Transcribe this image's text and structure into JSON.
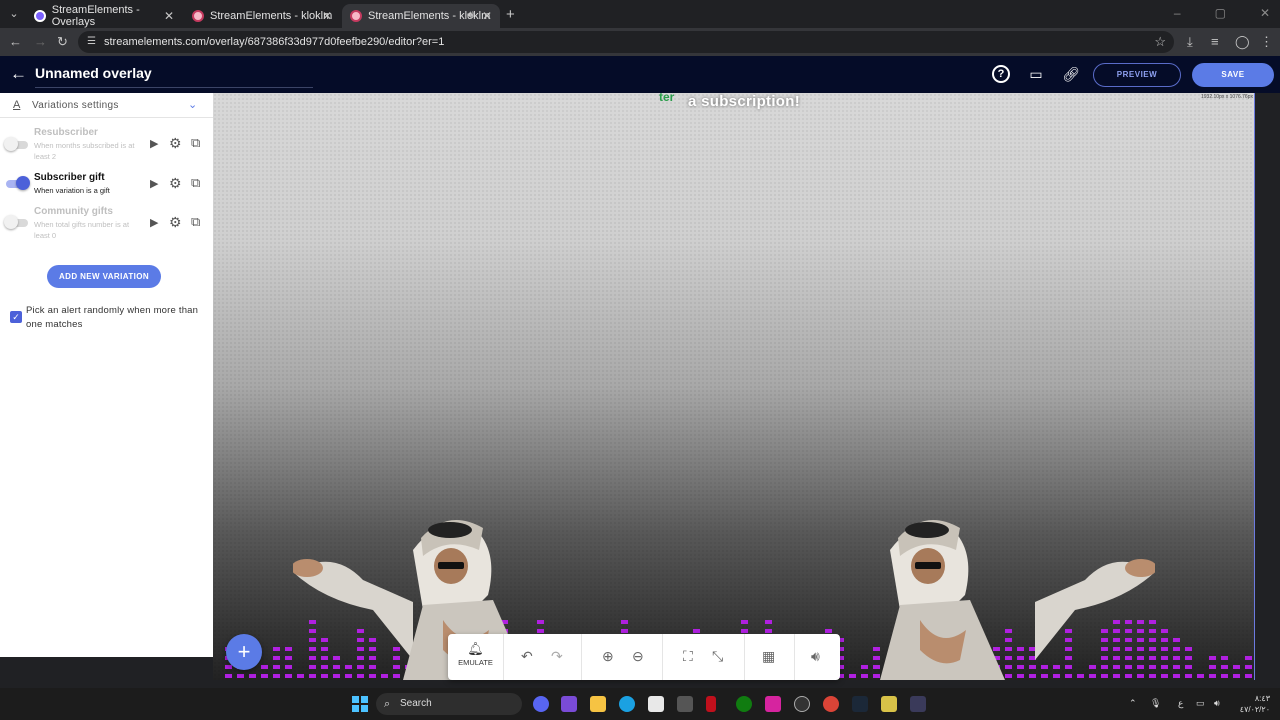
{
  "browser": {
    "tabs": [
      {
        "title": "StreamElements - Overlays",
        "active": false
      },
      {
        "title": "StreamElements - kloklm",
        "active": false
      },
      {
        "title": "StreamElements - kloklm",
        "active": true
      }
    ],
    "url": "streamelements.com/overlay/687386f33d977d0feefbe290/editor?er=1"
  },
  "header": {
    "title": "Unnamed overlay",
    "preview_label": "PREVIEW",
    "save_label": "SAVE"
  },
  "panel": {
    "section_title": "Variations settings",
    "variations": [
      {
        "name": "Resubscriber",
        "desc": "When months subscribed is at least 2",
        "enabled": false
      },
      {
        "name": "Subscriber gift",
        "desc": "When variation is a gift",
        "enabled": true
      },
      {
        "name": "Community gifts",
        "desc": "When total gifts number is at least 0",
        "enabled": false
      }
    ],
    "add_variation_label": "ADD NEW VARIATION",
    "random_pick_label": "Pick an alert randomly when more than one matches",
    "random_pick_checked": true
  },
  "canvas": {
    "alert_prefix": "ter",
    "alert_text": "a subscription!",
    "dimensions_text": "1932.10px x 1076.76px"
  },
  "toolbar": {
    "emulate_label": "EMULATE"
  },
  "taskbar": {
    "search_placeholder": "Search",
    "clock_time": "٨:٤٣",
    "clock_date": "٤٧/٠٢/٢٠",
    "lang": "ع"
  },
  "colors": {
    "accent": "#5b7be6",
    "header_bg": "#050c28",
    "eq_bar": "#b020e0"
  }
}
